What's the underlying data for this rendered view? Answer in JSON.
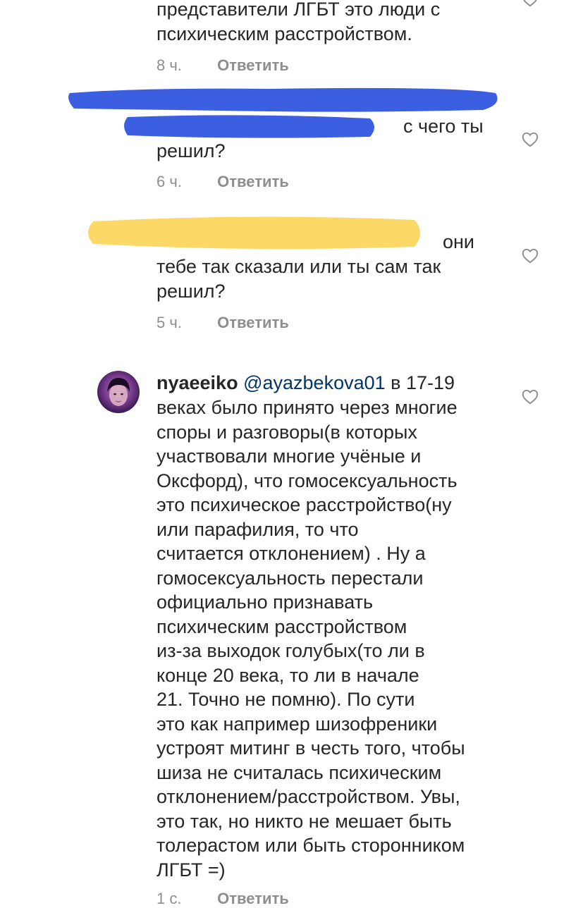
{
  "comments": [
    {
      "lines": [
        "представители ЛГБТ это люди с",
        "психическим расстройством."
      ],
      "time": "8 ч.",
      "reply_label": "Ответить"
    },
    {
      "lines": [
        "с чего ты",
        "решил?"
      ],
      "time": "6 ч.",
      "reply_label": "Ответить",
      "redaction_color": "#3b5fe0"
    },
    {
      "lines": [
        "они",
        "тебе так сказали или ты сам так",
        "решил?"
      ],
      "time": "5 ч.",
      "reply_label": "Ответить",
      "redaction_color": "#fcd867"
    },
    {
      "username": "nyaeeiko",
      "mention": "@ayazbekova01",
      "first_line_rest": "в 17-19",
      "lines": [
        "веках было принято через многие",
        "споры и разговоры(в которых",
        "участвовали многие учёные и",
        "Оксфорд), что гомосексуальность",
        "это психическое расстройство(ну",
        "или парафилия, то что",
        "считается отклонением) . Ну а",
        "гомосексуальность перестали",
        "официально признавать",
        "психическим расстройством",
        "из-за выходок голубых(то ли в",
        "конце 20 века, то ли в начале",
        "21. Точно не помню). По сути",
        "это как например шизофреники",
        "устроят митинг в честь того, чтобы",
        "шиза не считалась психическим",
        "отклонением/расстройством. Увы,",
        "это так, но никто не мешает быть",
        "толерастом или быть сторонником",
        "ЛГБТ =)"
      ],
      "time": "1 с.",
      "reply_label": "Ответить"
    }
  ],
  "colors": {
    "text": "#262626",
    "meta": "#8e8e8e",
    "mention": "#003569",
    "heart_stroke": "#8e8e8e"
  },
  "icons": {
    "like": "heart-outline-icon"
  }
}
